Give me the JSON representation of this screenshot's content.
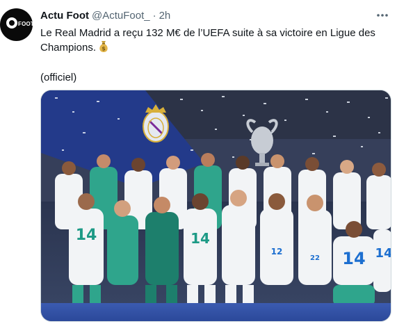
{
  "tweet": {
    "author_name": "Actu Foot",
    "author_handle": "@ActuFoot_",
    "separator": "·",
    "timestamp": "2h",
    "text_line": "Le Real Madrid a reçu 132 M€ de l’UEFA suite à sa victoire en Ligue des Champions.",
    "text_official": "(officiel)",
    "avatar_logo_text": "FOOT",
    "emoji": "money-bag-icon",
    "photo": {
      "description_icon": "team-celebration-photo",
      "jersey_numbers": [
        "14",
        "14",
        "14",
        "14",
        "12",
        "22"
      ]
    }
  },
  "colors": {
    "text_primary": "#0f1419",
    "text_secondary": "#536471",
    "avatar_bg": "#0a0a0a",
    "photo_banner": "#233a8a",
    "jersey_white": "#f2f4f6",
    "jersey_teal": "#2fa58c"
  }
}
